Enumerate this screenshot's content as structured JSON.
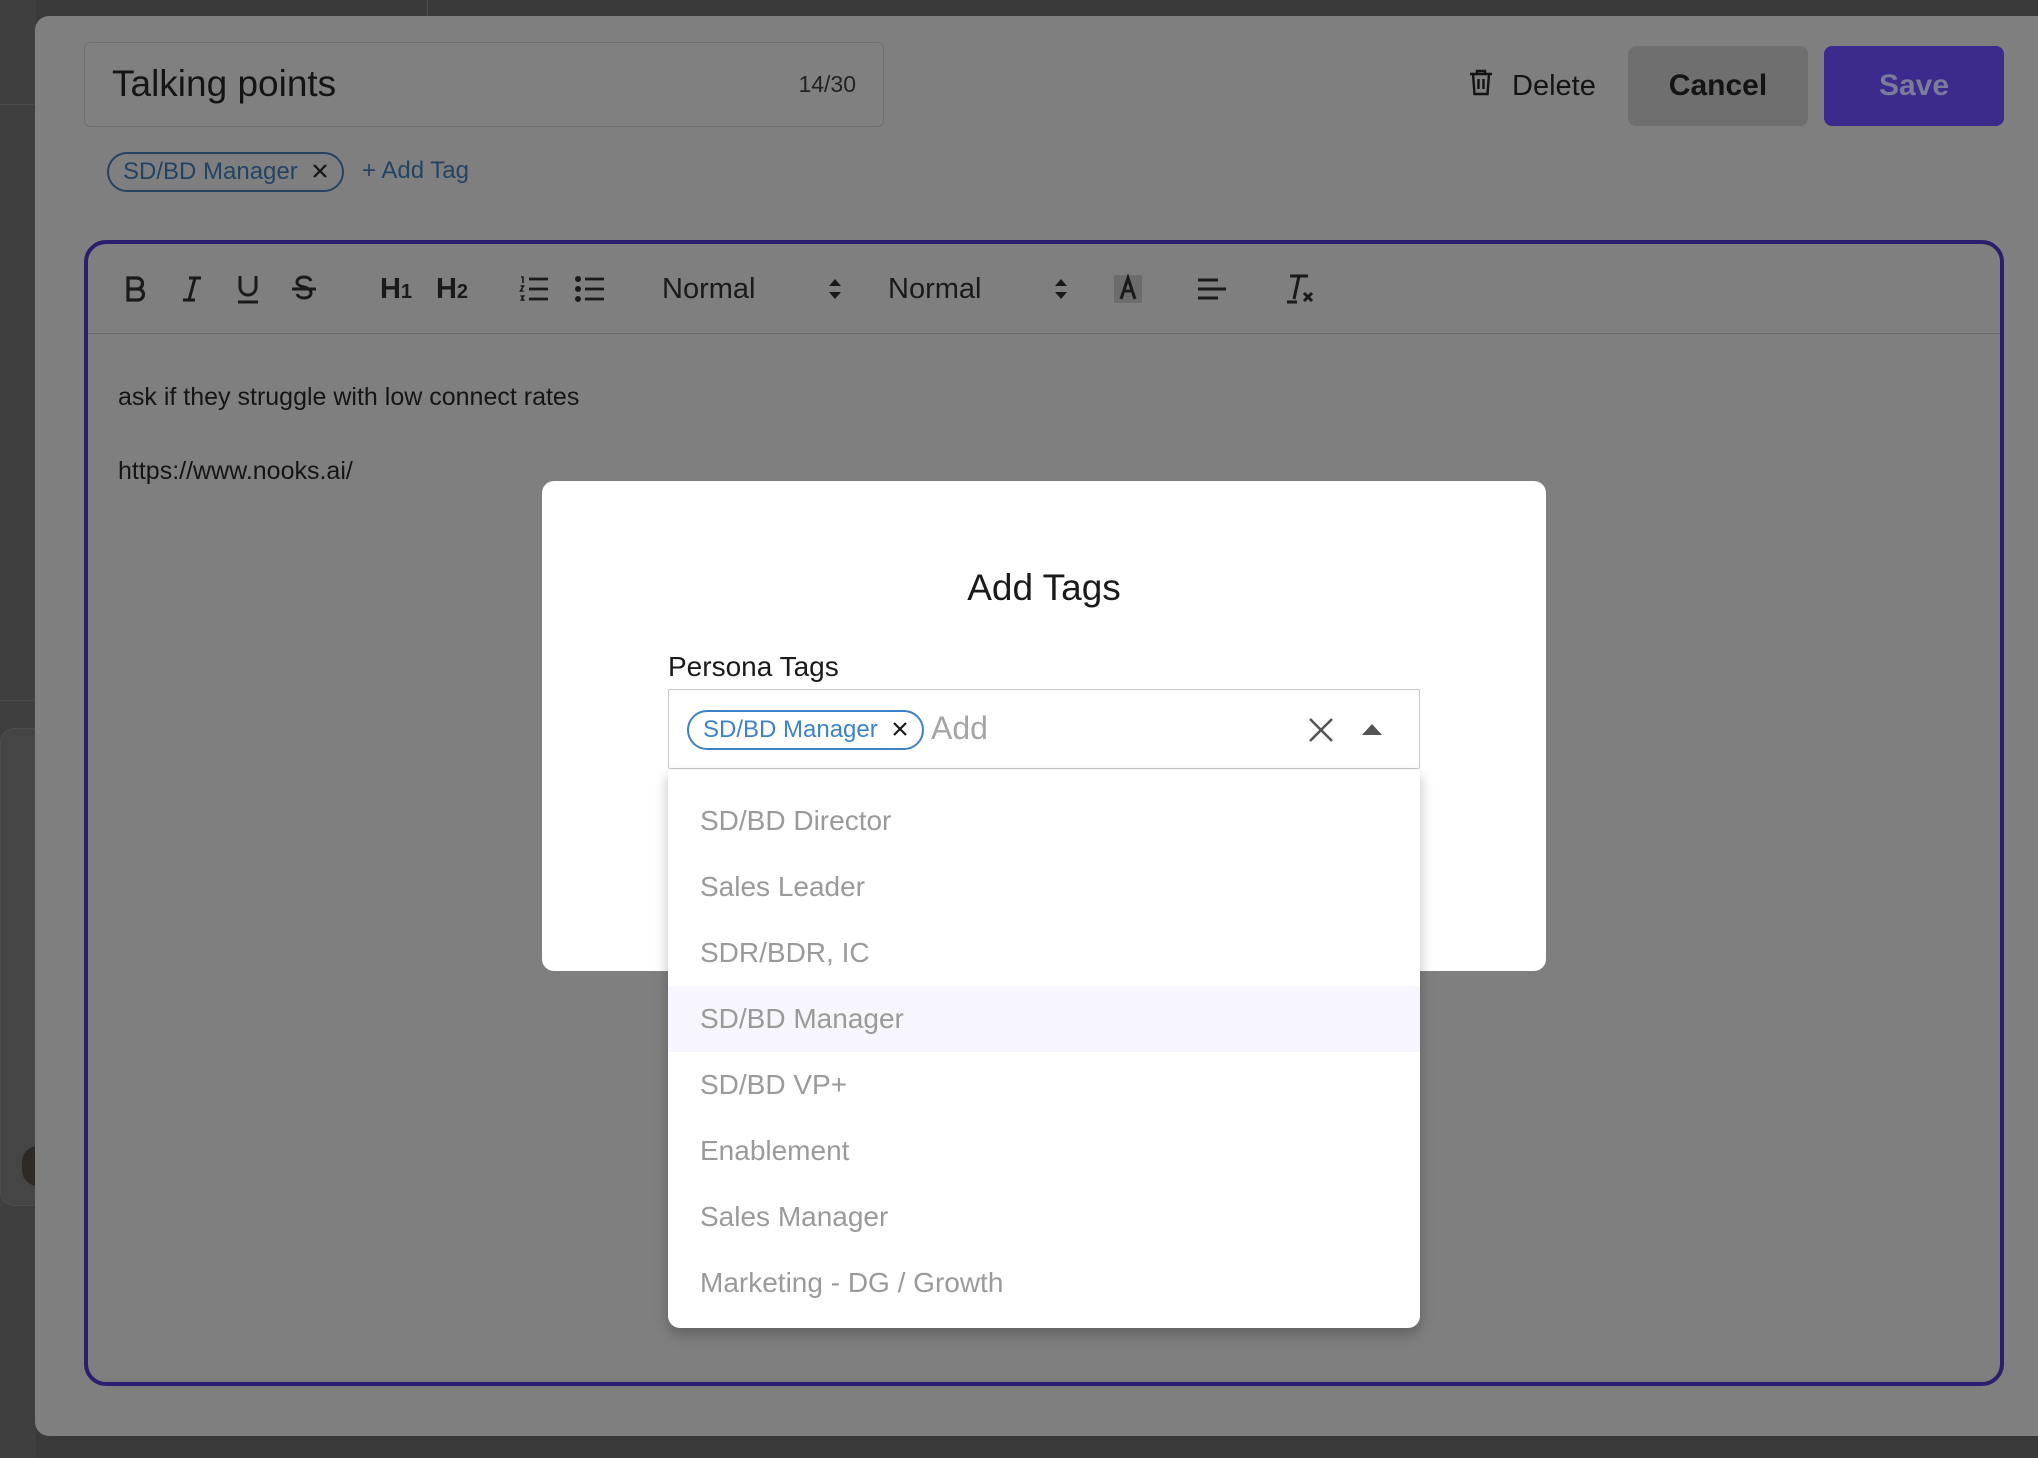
{
  "note": {
    "title": "Talking points",
    "char_count": "14/30",
    "tags": [
      "SD/BD Manager"
    ],
    "add_tag_label": "+ Add Tag",
    "body_lines": [
      "ask if they struggle with low connect rates",
      "https://www.nooks.ai/"
    ]
  },
  "actions": {
    "delete_label": "Delete",
    "cancel_label": "Cancel",
    "save_label": "Save"
  },
  "toolbar": {
    "font_select": "Normal",
    "size_select": "Normal",
    "buttons": [
      "bold-icon",
      "italic-icon",
      "underline-icon",
      "strikethrough-icon",
      "heading-1-icon",
      "heading-2-icon",
      "ordered-list-icon",
      "bullet-list-icon",
      "text-color-icon",
      "align-left-icon",
      "clear-format-icon"
    ]
  },
  "modal": {
    "title": "Add Tags",
    "field_label": "Persona Tags",
    "selected_tag": "SD/BD Manager",
    "placeholder": "Add",
    "options": [
      "SD/BD Director",
      "Sales Leader",
      "SDR/BDR, IC",
      "SD/BD Manager",
      "SD/BD VP+",
      "Enablement",
      "Sales Manager",
      "Marketing - DG / Growth"
    ],
    "highlighted_option": "SD/BD Manager"
  },
  "colors": {
    "accent": "#5a3fd6",
    "tag_blue": "#3d82c9",
    "overlay": "#7f7f7f"
  }
}
